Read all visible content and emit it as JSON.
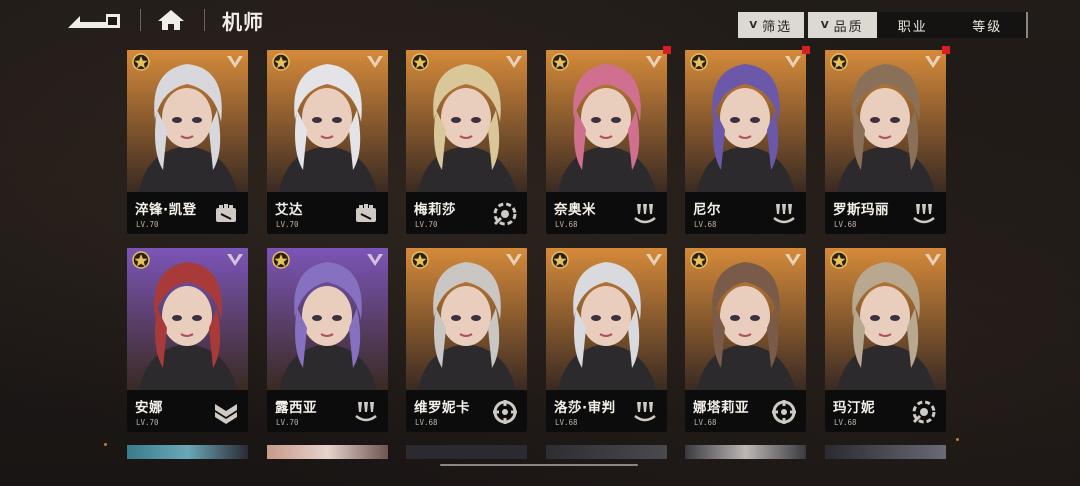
{
  "header": {
    "title": "机师"
  },
  "filter_bar": {
    "filter_label": "筛选",
    "quality_label": "品质",
    "class_label": "职业",
    "level_label": "等级"
  },
  "pilots": [
    {
      "name": "淬锋·凯登",
      "level": "LV.70",
      "quality": "gold",
      "class_icon": "fist-icon",
      "new": false
    },
    {
      "name": "艾达",
      "level": "LV.70",
      "quality": "gold",
      "class_icon": "fist-icon",
      "new": false
    },
    {
      "name": "梅莉莎",
      "level": "LV.70",
      "quality": "gold",
      "class_icon": "wrench-gear-icon",
      "new": false
    },
    {
      "name": "奈奥米",
      "level": "LV.68",
      "quality": "gold",
      "class_icon": "triple-drop-icon",
      "new": true
    },
    {
      "name": "尼尔",
      "level": "LV.68",
      "quality": "gold",
      "class_icon": "triple-drop-icon",
      "new": true
    },
    {
      "name": "罗斯玛丽",
      "level": "LV.68",
      "quality": "gold",
      "class_icon": "triple-drop-icon",
      "new": true
    },
    {
      "name": "安娜",
      "level": "LV.70",
      "quality": "purple",
      "class_icon": "chevron-shield-icon",
      "new": false
    },
    {
      "name": "露西亚",
      "level": "LV.70",
      "quality": "purple",
      "class_icon": "triple-drop-icon",
      "new": false
    },
    {
      "name": "维罗妮卡",
      "level": "LV.68",
      "quality": "gold",
      "class_icon": "crosshair-icon",
      "new": false
    },
    {
      "name": "洛莎·审判",
      "level": "LV.68",
      "quality": "gold",
      "class_icon": "triple-drop-icon",
      "new": false
    },
    {
      "name": "娜塔莉亚",
      "level": "LV.68",
      "quality": "gold",
      "class_icon": "crosshair-icon",
      "new": false
    },
    {
      "name": "玛汀妮",
      "level": "LV.68",
      "quality": "gold",
      "class_icon": "wrench-gear-icon",
      "new": false
    }
  ],
  "colors": {
    "gold_quality": "#d58a3a",
    "purple_quality": "#7b55b8",
    "new_badge": "#d61f1f",
    "info_bar": "#0d0c0c"
  }
}
